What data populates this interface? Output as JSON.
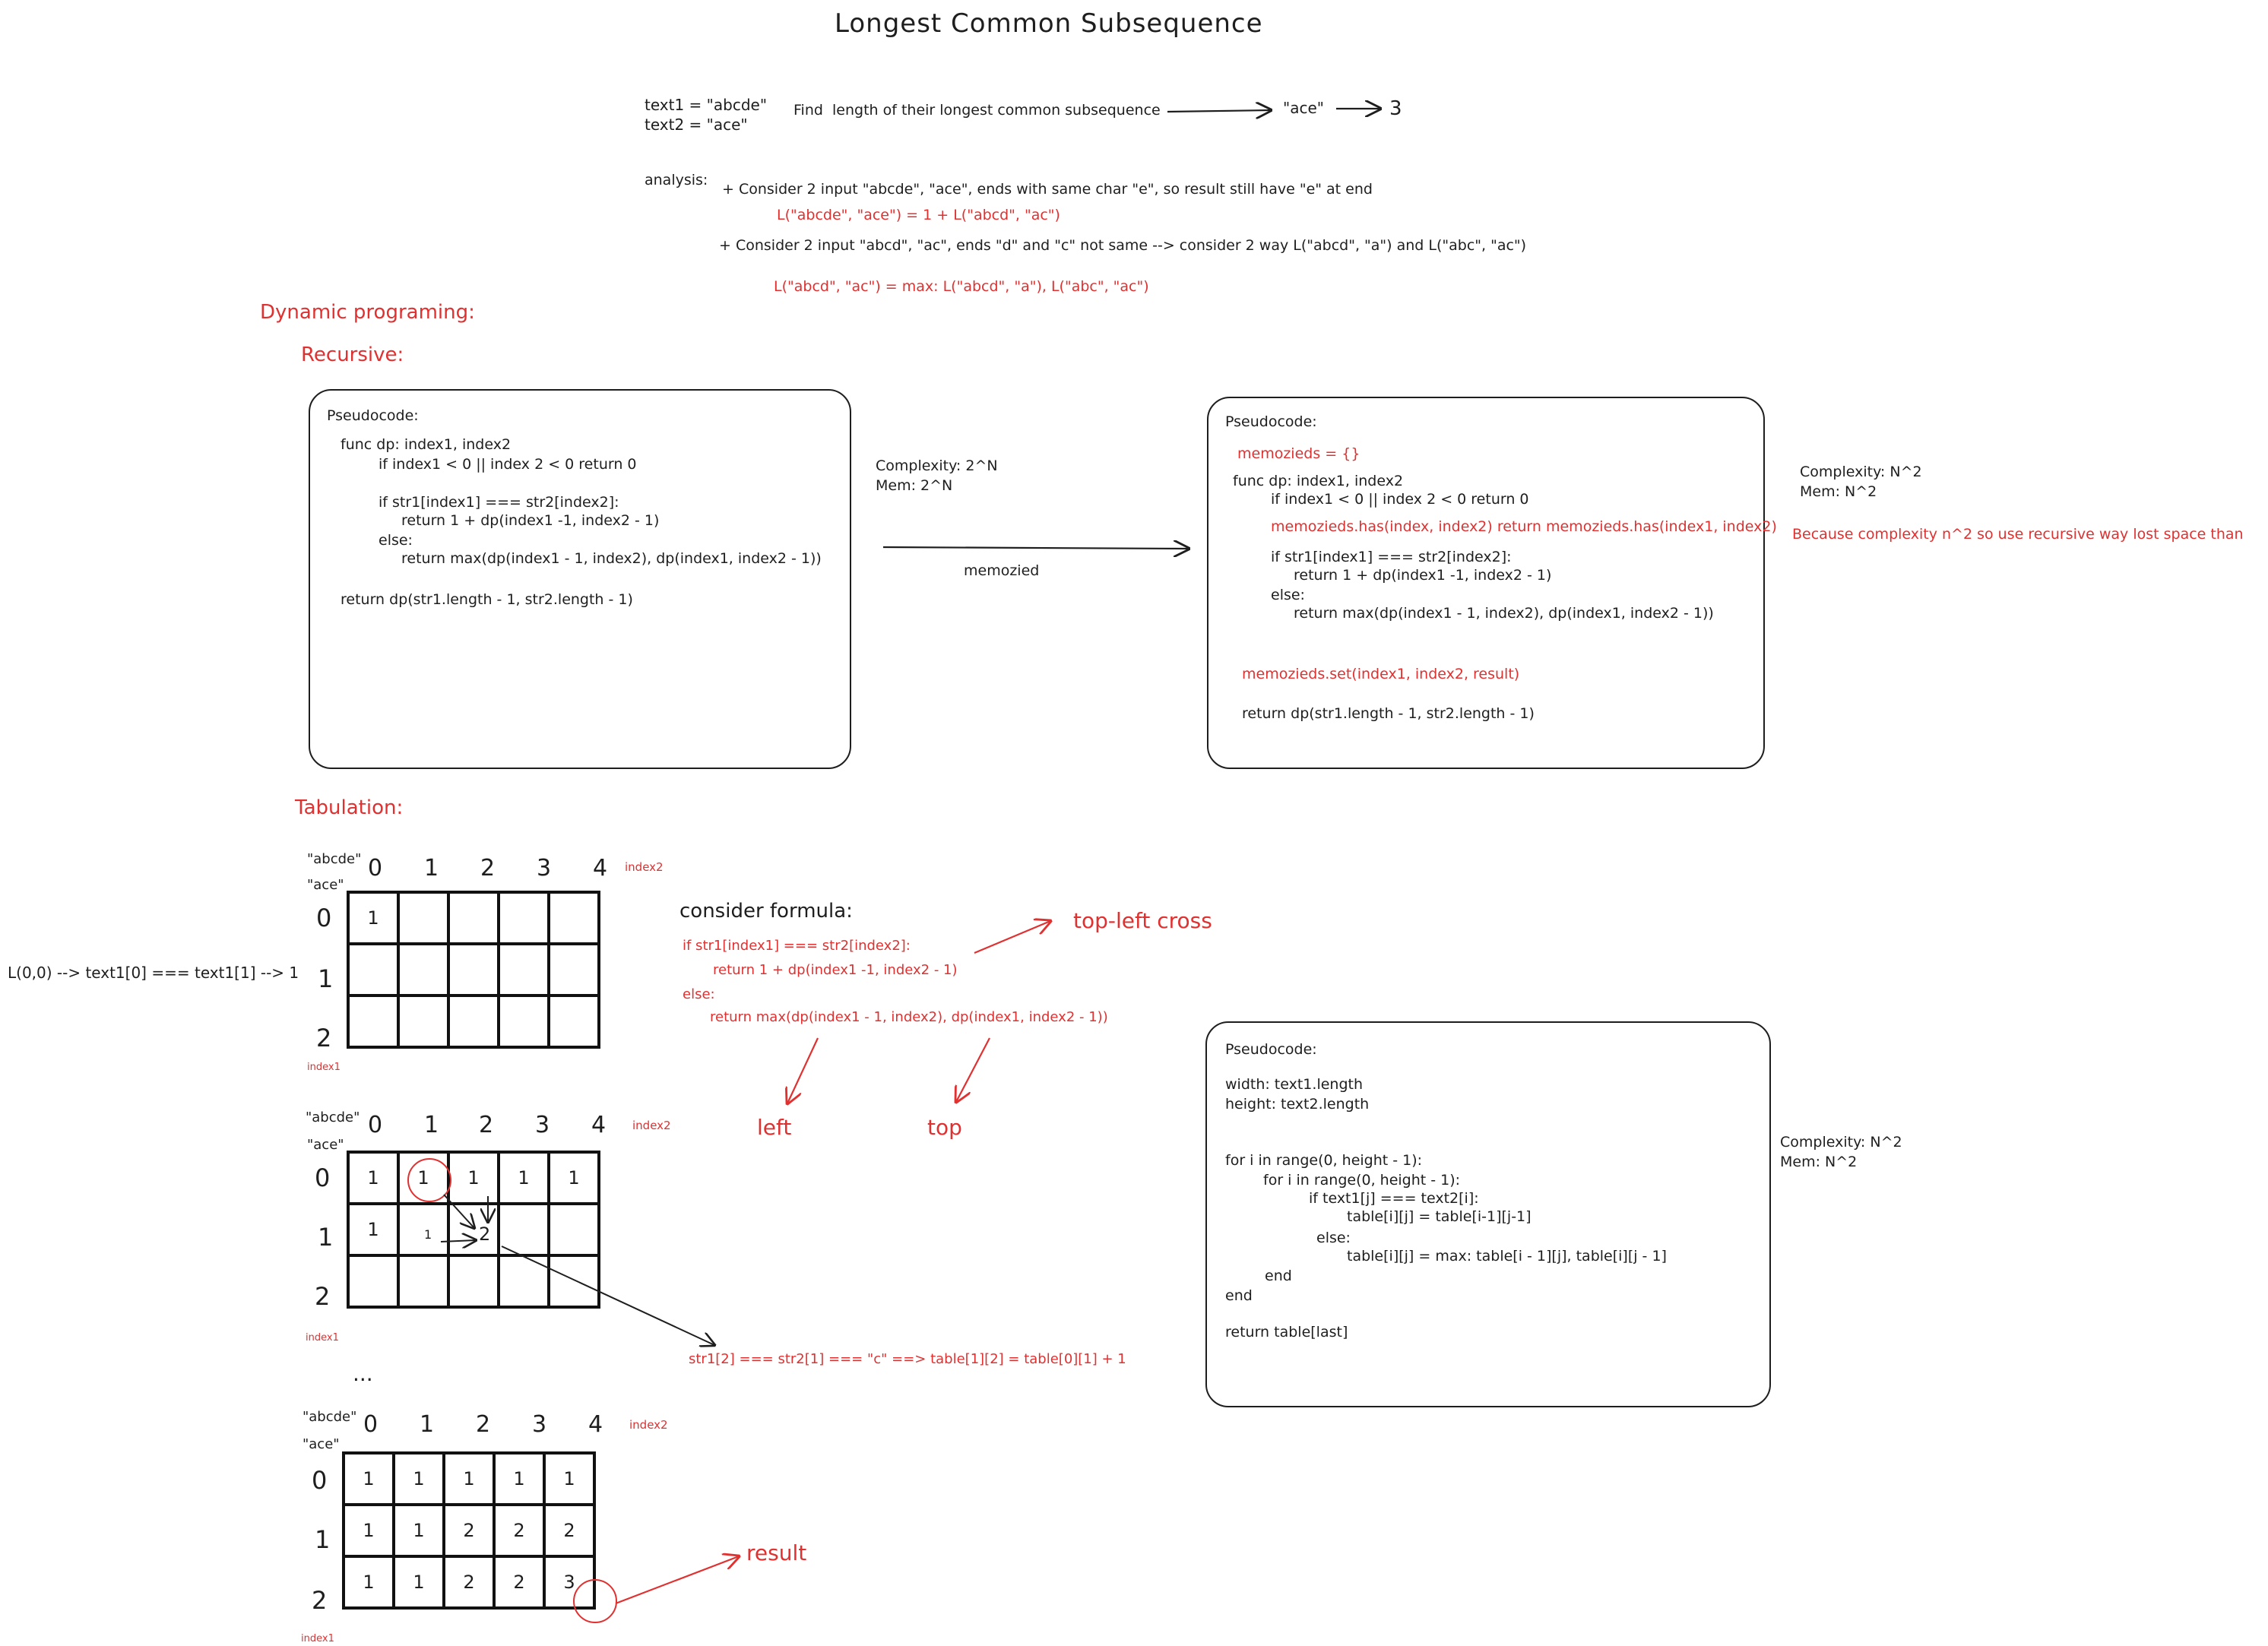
{
  "title": "Longest Common Subsequence",
  "problem": {
    "text1": "text1 = \"abcde\"",
    "text2": "text2 = \"ace\"",
    "find": "Find  length of their longest common subsequence",
    "result_str": "\"ace\"",
    "result_num": "3"
  },
  "analysis": {
    "label": "analysis:",
    "line1": "+ Consider 2 input \"abcde\", \"ace\", ends with same char \"e\", so result still have \"e\" at end",
    "line1_red": "L(\"abcde\", \"ace\") = 1 + L(\"abcd\", \"ac\")",
    "line2": "+ Consider 2 input \"abcd\", \"ac\", ends \"d\" and \"c\" not same --> consider 2 way L(\"abcd\", \"a\") and L(\"abc\", \"ac\")",
    "line2_red": "L(\"abcd\", \"ac\") = max: L(\"abcd\", \"a\"), L(\"abc\", \"ac\")"
  },
  "headings": {
    "dp": "Dynamic programing:",
    "recursive": "Recursive:",
    "tabulation": "Tabulation:"
  },
  "recursive_box": {
    "lines": [
      "Pseudocode:",
      "func dp: index1, index2",
      "if index1 < 0 || index 2 < 0 return 0",
      "if str1[index1] === str2[index2]:",
      "return 1 + dp(index1 -1, index2 - 1)",
      "else:",
      "return max(dp(index1 - 1, index2), dp(index1, index2 - 1))",
      "return dp(str1.length - 1, str2.length - 1)"
    ]
  },
  "recursive_complexity": {
    "c": "Complexity: 2^N",
    "m": "Mem: 2^N"
  },
  "memoized_arrow_label": "memozied",
  "memo_box": {
    "pseudocode": "Pseudocode:",
    "memo_init": "memozieds = {}",
    "func": "func dp: index1, index2",
    "if_base": "if index1 < 0 || index 2 < 0 return 0",
    "memo_has": "memozieds.has(index, index2) return memozieds.has(index1, index2)",
    "if_eq": "if str1[index1] === str2[index2]:",
    "ret1": "return 1 + dp(index1 -1, index2 - 1)",
    "else": "else:",
    "ret_max": "return max(dp(index1 - 1, index2), dp(index1, index2 - 1))",
    "memo_set": "memozieds.set(index1, index2, result)",
    "ret_final": "return dp(str1.length - 1, str2.length - 1)"
  },
  "memo_complexity": {
    "c": "Complexity: N^2",
    "m": "Mem: N^2",
    "note": "Because complexity n^2 so use recursive way lost space than"
  },
  "grid_labels": {
    "abcde": "\"abcde\"",
    "ace": "\"ace\"",
    "index2": "index2",
    "index1": "index1",
    "cols": [
      "0",
      "1",
      "2",
      "3",
      "4"
    ],
    "rows": [
      "0",
      "1",
      "2"
    ]
  },
  "grid1": [
    [
      "1",
      "",
      "",
      "",
      ""
    ],
    [
      "",
      "",
      "",
      "",
      ""
    ],
    [
      "",
      "",
      "",
      "",
      ""
    ]
  ],
  "grid2": [
    [
      "1",
      "1",
      "1",
      "1",
      "1"
    ],
    [
      "1",
      "",
      "",
      "",
      ""
    ],
    [
      "",
      "",
      "",
      "",
      ""
    ]
  ],
  "grid2_arrow_label": "2",
  "grid3": [
    [
      "1",
      "1",
      "1",
      "1",
      "1"
    ],
    [
      "1",
      "1",
      "2",
      "2",
      "2"
    ],
    [
      "1",
      "1",
      "2",
      "2",
      "3"
    ]
  ],
  "l00": "L(0,0) --> text1[0] === text1[1] --> 1",
  "formula": {
    "heading": "consider formula:",
    "l1": "if str1[index1] === str2[index2]:",
    "l2": "return 1 + dp(index1 -1, index2 - 1)",
    "l3": "else:",
    "l4": "return max(dp(index1 - 1, index2), dp(index1, index2 - 1))",
    "topleft": "top-left cross",
    "left": "left",
    "top": "top"
  },
  "str_eq": "str1[2] === str2[1] === \"c\" ==> table[1][2] = table[0][1] + 1",
  "ellipsis": "...",
  "result_label": "result",
  "tab_box": {
    "lines": [
      "Pseudocode:",
      "width: text1.length",
      "height: text2.length",
      "for i in range(0, height - 1):",
      "for i in range(0, height - 1):",
      "if text1[j] === text2[i]:",
      "table[i][j] = table[i-1][j-1]",
      "else:",
      "table[i][j] = max: table[i - 1][j], table[i][j - 1]",
      "end",
      "end",
      "return table[last]"
    ]
  },
  "tab_complexity": {
    "c": "Complexity: N^2",
    "m": "Mem: N^2"
  }
}
